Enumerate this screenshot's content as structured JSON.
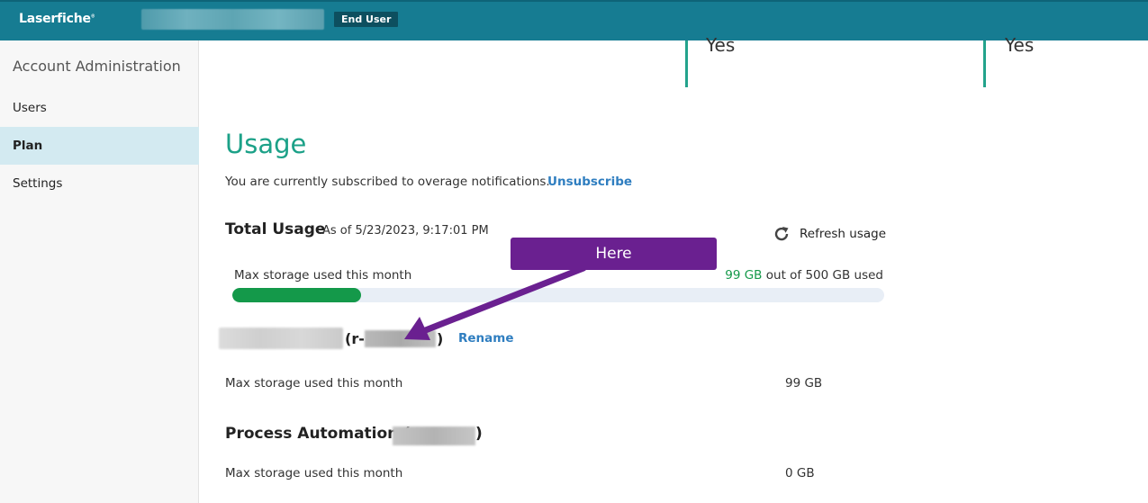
{
  "header": {
    "logo": "Laserfiche",
    "role_badge": "End User"
  },
  "sidebar": {
    "title": "Account Administration",
    "items": [
      {
        "label": "Users",
        "selected": false
      },
      {
        "label": "Plan",
        "selected": true
      },
      {
        "label": "Settings",
        "selected": false
      }
    ]
  },
  "features": {
    "values": [
      "Yes",
      "Yes"
    ]
  },
  "usage": {
    "title": "Usage",
    "subscription_text": "You are currently subscribed to overage notifications.",
    "unsubscribe_label": "Unsubscribe",
    "total_usage_label": "Total Usage",
    "as_of": "As of 5/23/2023, 9:17:01 PM",
    "refresh_label": "Refresh usage",
    "storage_label": "Max storage used this month",
    "storage_used_value": "99 GB",
    "storage_used_suffix": "out of 500 GB used",
    "storage_fraction": 0.198
  },
  "repository": {
    "name_prefix": "(r-",
    "name_suffix": ")",
    "rename_label": "Rename",
    "storage_label": "Max storage used this month",
    "storage_value": "99 GB"
  },
  "process_automation": {
    "title": "Process Automation (",
    "title_close": ")",
    "storage_label": "Max storage used this month",
    "storage_value": "0 GB"
  },
  "annotation": {
    "callout_text": "Here",
    "color": "#6a2090"
  },
  "colors": {
    "header": "#167c92",
    "accent": "#1ca188",
    "progress": "#14994a",
    "link": "#2f7ec0",
    "nav_selected": "#d3eaf1"
  }
}
